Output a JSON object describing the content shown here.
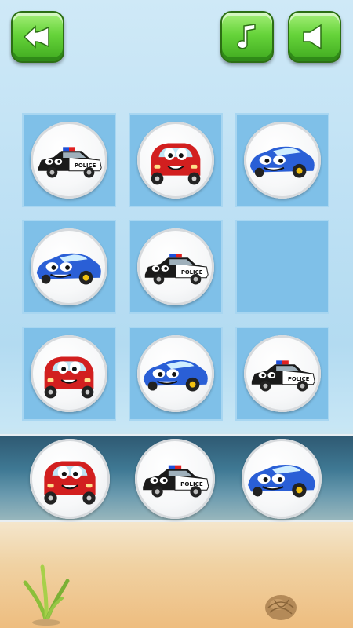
{
  "toolbar": {
    "back_icon": "fish-back-arrow-icon",
    "music_icon": "music-note-icon",
    "sound_icon": "speaker-icon",
    "button_color": "#5cc935"
  },
  "board": {
    "rows": 3,
    "cols": 3,
    "tiles": [
      {
        "piece": "police-car"
      },
      {
        "piece": "red-car"
      },
      {
        "piece": "blue-car"
      },
      {
        "piece": "blue-car"
      },
      {
        "piece": "police-car"
      },
      {
        "piece": "empty"
      },
      {
        "piece": "red-car"
      },
      {
        "piece": "blue-car"
      },
      {
        "piece": "police-car"
      }
    ],
    "tile_color": "#7fc0e8"
  },
  "tray": {
    "pieces": [
      "red-car",
      "police-car",
      "blue-car"
    ]
  },
  "police_label": "POLICE"
}
